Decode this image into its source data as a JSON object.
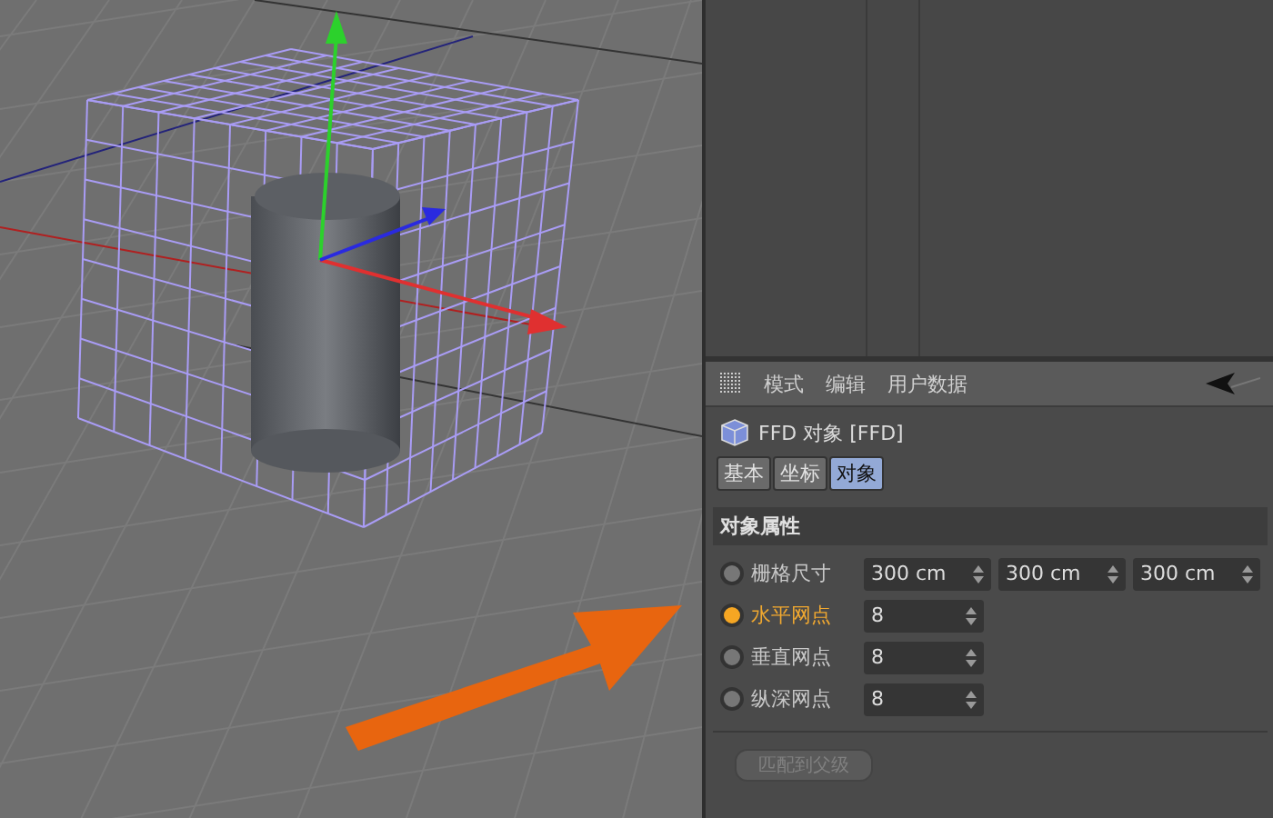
{
  "menu": [
    "模式",
    "编辑",
    "用户数据"
  ],
  "object": {
    "name": "FFD 对象 [FFD]"
  },
  "tabs": [
    {
      "label": "基本",
      "selected": false
    },
    {
      "label": "坐标",
      "selected": false
    },
    {
      "label": "对象",
      "selected": true
    }
  ],
  "section": "对象属性",
  "params": [
    {
      "label": "栅格尺寸",
      "active": false,
      "values": [
        "300 cm",
        "300 cm",
        "300 cm"
      ]
    },
    {
      "label": "水平网点",
      "active": true,
      "values": [
        "8"
      ]
    },
    {
      "label": "垂直网点",
      "active": false,
      "values": [
        "8"
      ]
    },
    {
      "label": "纵深网点",
      "active": false,
      "values": [
        "8"
      ]
    }
  ],
  "button": {
    "label": "匹配到父级",
    "disabled": true
  }
}
